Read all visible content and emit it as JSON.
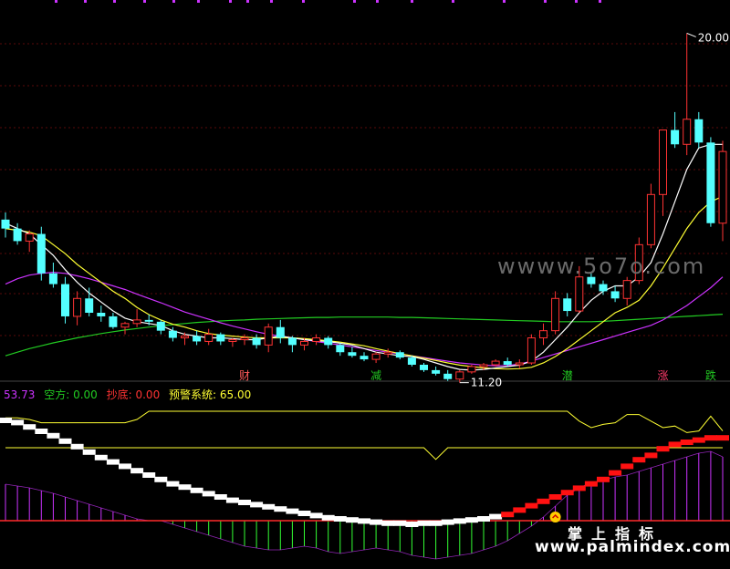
{
  "chart_data": {
    "type": "candlestick",
    "price_top": 20.8,
    "price_bottom": 10.75,
    "candles": [
      [
        14.8,
        15.0,
        14.3,
        14.55
      ],
      [
        14.55,
        14.7,
        14.1,
        14.2
      ],
      [
        14.2,
        14.5,
        13.9,
        14.4
      ],
      [
        14.4,
        14.6,
        13.1,
        13.3
      ],
      [
        13.3,
        13.6,
        12.9,
        13.0
      ],
      [
        13.0,
        13.2,
        11.9,
        12.1
      ],
      [
        12.1,
        12.8,
        11.85,
        12.6
      ],
      [
        12.6,
        12.9,
        12.1,
        12.2
      ],
      [
        12.2,
        12.4,
        11.95,
        12.1
      ],
      [
        12.1,
        12.2,
        11.75,
        11.8
      ],
      [
        11.8,
        11.95,
        11.6,
        11.9
      ],
      [
        11.9,
        12.3,
        11.8,
        12.0
      ],
      [
        12.0,
        12.15,
        11.85,
        11.95
      ],
      [
        11.95,
        12.0,
        11.6,
        11.7
      ],
      [
        11.7,
        11.8,
        11.4,
        11.5
      ],
      [
        11.5,
        11.65,
        11.3,
        11.55
      ],
      [
        11.55,
        11.7,
        11.3,
        11.4
      ],
      [
        11.4,
        11.75,
        11.3,
        11.6
      ],
      [
        11.6,
        11.65,
        11.3,
        11.4
      ],
      [
        11.4,
        11.5,
        11.25,
        11.45
      ],
      [
        11.45,
        11.6,
        11.3,
        11.5
      ],
      [
        11.5,
        11.6,
        11.2,
        11.3
      ],
      [
        11.3,
        11.9,
        11.1,
        11.8
      ],
      [
        11.8,
        12.0,
        11.35,
        11.5
      ],
      [
        11.5,
        11.55,
        11.1,
        11.3
      ],
      [
        11.3,
        11.5,
        11.15,
        11.4
      ],
      [
        11.4,
        11.6,
        11.3,
        11.5
      ],
      [
        11.5,
        11.55,
        11.2,
        11.3
      ],
      [
        11.3,
        11.35,
        11.0,
        11.1
      ],
      [
        11.1,
        11.25,
        10.95,
        11.0
      ],
      [
        11.0,
        11.1,
        10.85,
        10.9
      ],
      [
        10.9,
        11.1,
        10.8,
        11.05
      ],
      [
        11.05,
        11.2,
        10.95,
        11.1
      ],
      [
        11.1,
        11.15,
        10.9,
        10.95
      ],
      [
        10.95,
        11.0,
        10.7,
        10.75
      ],
      [
        10.75,
        10.8,
        10.55,
        10.6
      ],
      [
        10.6,
        10.7,
        10.45,
        10.5
      ],
      [
        10.5,
        10.6,
        10.3,
        10.35
      ],
      [
        10.35,
        10.6,
        10.25,
        10.55
      ],
      [
        10.55,
        10.75,
        10.5,
        10.7
      ],
      [
        10.7,
        10.8,
        10.6,
        10.75
      ],
      [
        10.75,
        10.9,
        10.7,
        10.85
      ],
      [
        10.85,
        10.95,
        10.7,
        10.75
      ],
      [
        10.75,
        10.9,
        10.65,
        10.8
      ],
      [
        10.8,
        11.6,
        10.75,
        11.5
      ],
      [
        11.5,
        11.9,
        11.3,
        11.7
      ],
      [
        11.7,
        12.8,
        11.6,
        12.6
      ],
      [
        12.6,
        12.75,
        12.1,
        12.25
      ],
      [
        12.25,
        13.5,
        12.2,
        13.2
      ],
      [
        13.2,
        13.3,
        12.9,
        13.0
      ],
      [
        13.0,
        13.1,
        12.7,
        12.8
      ],
      [
        12.8,
        12.95,
        12.5,
        12.6
      ],
      [
        12.6,
        13.2,
        12.4,
        13.1
      ],
      [
        13.1,
        14.3,
        13.0,
        14.1
      ],
      [
        14.1,
        15.8,
        14.0,
        15.5
      ],
      [
        15.5,
        16.2,
        14.9,
        17.3
      ],
      [
        17.3,
        17.8,
        16.8,
        16.9
      ],
      [
        16.9,
        20.0,
        16.6,
        17.6
      ],
      [
        17.6,
        17.8,
        16.8,
        16.95
      ],
      [
        16.95,
        17.1,
        14.6,
        14.7
      ],
      [
        14.7,
        17.0,
        14.2,
        16.7
      ]
    ],
    "ma_white": [
      14.7,
      14.55,
      14.4,
      14.1,
      13.8,
      13.4,
      13.05,
      12.75,
      12.5,
      12.25,
      12.05,
      11.95,
      11.9,
      11.85,
      11.7,
      11.6,
      11.55,
      11.5,
      11.5,
      11.48,
      11.45,
      11.45,
      11.5,
      11.55,
      11.5,
      11.45,
      11.42,
      11.4,
      11.35,
      11.3,
      11.2,
      11.1,
      11.05,
      11.0,
      10.98,
      10.9,
      10.8,
      10.7,
      10.62,
      10.6,
      10.62,
      10.66,
      10.7,
      10.74,
      10.85,
      11.1,
      11.45,
      11.8,
      12.2,
      12.55,
      12.8,
      12.95,
      12.95,
      13.2,
      13.6,
      14.4,
      15.3,
      16.2,
      16.8,
      16.9,
      16.9
    ],
    "ma_yellow": [
      14.55,
      14.5,
      14.45,
      14.35,
      14.1,
      13.85,
      13.55,
      13.3,
      13.05,
      12.8,
      12.6,
      12.35,
      12.15,
      12.0,
      11.88,
      11.8,
      11.7,
      11.62,
      11.58,
      11.55,
      11.52,
      11.5,
      11.5,
      11.5,
      11.5,
      11.48,
      11.45,
      11.42,
      11.38,
      11.33,
      11.28,
      11.2,
      11.13,
      11.06,
      11.0,
      10.93,
      10.87,
      10.8,
      10.74,
      10.7,
      10.66,
      10.64,
      10.63,
      10.64,
      10.68,
      10.8,
      10.98,
      11.2,
      11.45,
      11.7,
      11.95,
      12.2,
      12.35,
      12.55,
      12.95,
      13.45,
      14.0,
      14.55,
      15.0,
      15.3,
      15.45
    ],
    "ma_magenta": [
      13.0,
      13.15,
      13.25,
      13.3,
      13.33,
      13.3,
      13.23,
      13.15,
      13.05,
      12.95,
      12.85,
      12.72,
      12.6,
      12.48,
      12.35,
      12.22,
      12.12,
      12.02,
      11.92,
      11.83,
      11.75,
      11.67,
      11.6,
      11.55,
      11.5,
      11.45,
      11.4,
      11.35,
      11.3,
      11.25,
      11.2,
      11.15,
      11.1,
      11.05,
      11.0,
      10.95,
      10.9,
      10.85,
      10.8,
      10.77,
      10.74,
      10.72,
      10.73,
      10.77,
      10.85,
      10.95,
      11.05,
      11.15,
      11.25,
      11.35,
      11.45,
      11.55,
      11.65,
      11.75,
      11.85,
      12.0,
      12.2,
      12.4,
      12.65,
      12.9,
      13.2
    ],
    "ma_green": [
      11.0,
      11.1,
      11.2,
      11.28,
      11.36,
      11.43,
      11.5,
      11.56,
      11.62,
      11.67,
      11.72,
      11.76,
      11.8,
      11.84,
      11.87,
      11.9,
      11.93,
      11.95,
      11.97,
      11.99,
      12.0,
      12.02,
      12.03,
      12.04,
      12.05,
      12.06,
      12.07,
      12.07,
      12.08,
      12.08,
      12.08,
      12.08,
      12.08,
      12.07,
      12.07,
      12.06,
      12.05,
      12.04,
      12.03,
      12.02,
      12.01,
      12.0,
      11.99,
      11.98,
      11.97,
      11.96,
      11.95,
      11.95,
      11.95,
      11.95,
      11.96,
      11.98,
      12.0,
      12.02,
      12.04,
      12.06,
      12.08,
      12.1,
      12.12,
      12.14,
      12.16
    ],
    "annotations": {
      "high_label": "20.00",
      "low_label": "11.20"
    },
    "bottom_labels": [
      {
        "text": "财",
        "i": 20,
        "color": "#ff5a5a"
      },
      {
        "text": "减",
        "i": 31,
        "color": "#22c722"
      },
      {
        "text": "潜",
        "i": 47,
        "color": "#22c722"
      },
      {
        "text": "涨",
        "i": 55,
        "color": "#ff3b6b"
      },
      {
        "text": "跌",
        "i": 59,
        "color": "#22c722"
      }
    ],
    "indicator": {
      "yellow_upper": [
        92,
        92,
        90,
        86,
        86,
        86,
        86,
        86,
        86,
        86,
        86,
        90,
        100,
        100,
        100,
        100,
        100,
        100,
        100,
        100,
        100,
        100,
        100,
        100,
        100,
        100,
        100,
        100,
        100,
        100,
        100,
        100,
        100,
        100,
        100,
        100,
        100,
        100,
        100,
        100,
        100,
        100,
        100,
        100,
        100,
        100,
        100,
        100,
        88,
        80,
        84,
        86,
        96,
        96,
        88,
        80,
        82,
        74,
        76,
        94,
        76
      ],
      "yellow_lower": [
        60,
        60,
        60,
        60,
        60,
        60,
        60,
        60,
        60,
        60,
        60,
        60,
        60,
        60,
        60,
        60,
        60,
        60,
        60,
        60,
        60,
        60,
        60,
        60,
        60,
        60,
        60,
        60,
        60,
        60,
        60,
        60,
        60,
        60,
        60,
        60,
        44,
        60,
        60,
        60,
        60,
        60,
        60,
        60,
        60,
        60,
        60,
        60,
        60,
        60,
        60,
        60,
        60,
        60,
        60,
        60,
        60,
        60,
        60,
        60,
        60
      ],
      "hist": [
        40,
        38,
        36,
        33,
        30,
        26,
        22,
        18,
        14,
        10,
        6,
        2,
        0,
        0,
        -4,
        -8,
        -12,
        -16,
        -20,
        -24,
        -28,
        -30,
        -32,
        -32,
        -30,
        -28,
        -30,
        -34,
        -36,
        -34,
        -32,
        -30,
        -32,
        -34,
        -38,
        -40,
        -42,
        -40,
        -38,
        -36,
        -32,
        -28,
        -22,
        -14,
        -6,
        4,
        16,
        28,
        36,
        42,
        44,
        48,
        50,
        54,
        58,
        62,
        66,
        70,
        74,
        76,
        70
      ],
      "steps": [
        92,
        90,
        86,
        82,
        78,
        73,
        68,
        63,
        58,
        54,
        50,
        46,
        42,
        38,
        34,
        31,
        28,
        25,
        22,
        19,
        17,
        15,
        13,
        11,
        9,
        7,
        5,
        3,
        2,
        1,
        0,
        -1,
        -2,
        -2,
        -3,
        -2,
        -2,
        -1,
        0,
        1,
        2,
        4,
        6,
        10,
        14,
        18,
        22,
        26,
        30,
        34,
        38,
        44,
        50,
        56,
        60,
        66,
        70,
        72,
        74,
        76,
        76
      ],
      "white_until": 41
    }
  },
  "legend": {
    "v_main": "53.73",
    "kong_label": "空方:",
    "kong_value": "0.00",
    "chao_label": "抄底:",
    "chao_value": "0.00",
    "warn_label": "预警系统:",
    "warn_value": "65.00"
  },
  "watermarks": {
    "top": "wwww.5o7o.com",
    "brand": "掌上指标",
    "url": "www.palmindex.com"
  },
  "colors": {
    "up": "#ff3333",
    "down": "#54ffff",
    "white": "#ffffff",
    "yellow": "#ffff33",
    "magenta": "#cc33ff",
    "green": "#22cc22",
    "grid": "#5a0a0a"
  }
}
